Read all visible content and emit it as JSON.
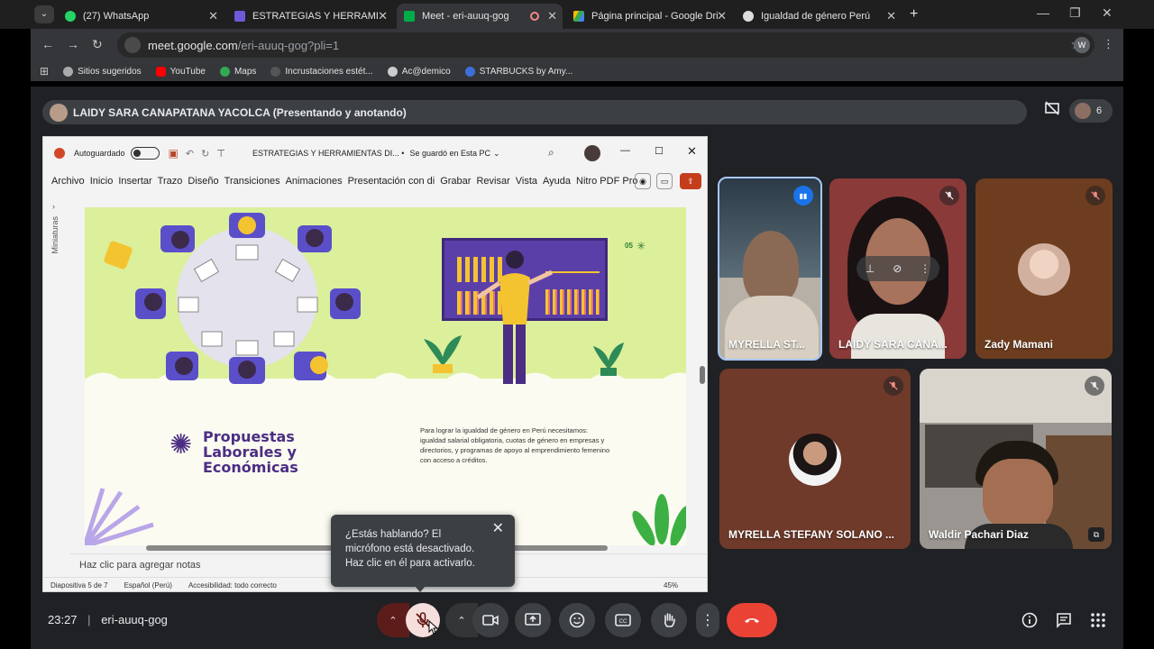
{
  "browser": {
    "tabs": [
      {
        "label": "(27) WhatsApp",
        "icon": "whatsapp-icon",
        "color": "#25d366"
      },
      {
        "label": "ESTRATEGIAS Y HERRAMIENTAS",
        "icon": "powerpoint-icon",
        "color": "#6b5bd8"
      },
      {
        "label": "Meet - eri-auuq-gog",
        "icon": "meet-icon",
        "color": "#00ac47",
        "active": true
      },
      {
        "label": "Página principal - Google Drive",
        "icon": "drive-icon",
        "color": "#fbbc04"
      },
      {
        "label": "Igualdad de género Perú",
        "icon": "chatgpt-icon",
        "color": "#dddddd"
      }
    ],
    "url_host": "meet.google.com",
    "url_path": "/eri-auuq-gog?pli=1",
    "profile_letter": "W",
    "bookmarks": [
      {
        "label": "Sitios sugeridos",
        "color": "#aaaaaa"
      },
      {
        "label": "YouTube",
        "color": "#ff0000"
      },
      {
        "label": "Maps",
        "color": "#34a853"
      },
      {
        "label": "Incrustaciones estét...",
        "color": "#555555"
      },
      {
        "label": "Ac@demico",
        "color": "#cccccc"
      },
      {
        "label": "STARBUCKS by Amy...",
        "color": "#3c6fd8"
      }
    ]
  },
  "meet": {
    "presenter_label": "LAIDY SARA CANAPATANA YACOLCA (Presentando y anotando)",
    "participant_count": "6",
    "time": "23:27",
    "meeting_code": "eri-auuq-gog",
    "tooltip": {
      "line1": "¿Estás hablando? El",
      "line2": "micrófono está desactivado.",
      "line3": "Haz clic en él para activarlo."
    },
    "participants": [
      {
        "name": "MYRELLA ST...",
        "bg": "#b6b0a6"
      },
      {
        "name": "LAIDY SARA CANA...",
        "bg": "#8a3a38"
      },
      {
        "name": "Zady Mamani",
        "bg": "#6e3d1f"
      },
      {
        "name": "MYRELLA STEFANY SOLANO ...",
        "bg": "#6f3a2a"
      },
      {
        "name": "Waldir Pachari Diaz",
        "bg": "#9a9590"
      }
    ]
  },
  "ppt": {
    "autosave_label": "Autoguardado",
    "title": "ESTRATEGIAS Y HERRAMIENTAS DI... •",
    "saved_label": "Se guardó en Esta PC",
    "menu": [
      "Archivo",
      "Inicio",
      "Insertar",
      "Trazo",
      "Diseño",
      "Transiciones",
      "Animaciones",
      "Presentación con di",
      "Grabar",
      "Revisar",
      "Vista",
      "Ayuda",
      "Nitro PDF Pro"
    ],
    "thumbnails_label": "Miniaturas",
    "slide": {
      "page_number": "05",
      "heading_line1": "Propuestas",
      "heading_line2": "Laborales y",
      "heading_line3": "Económicas",
      "body": "Para lograr la igualdad de género en Perú necesitamos: igualdad salarial obligatoria, cuotas de género en empresas y directorios, y programas de apoyo al emprendimiento femenino con acceso a créditos."
    },
    "notes_placeholder": "Haz clic para agregar notas",
    "status": {
      "slide_of": "Diapositiva 5 de 7",
      "language": "Español (Perú)",
      "accessibility": "Accesibilidad: todo correcto",
      "zoom": "45%"
    }
  },
  "colors": {
    "end_call": "#ea4335",
    "mic_off": "#f6dedc",
    "slide_purple": "#4b2e83",
    "slide_green": "#dcef9b"
  }
}
